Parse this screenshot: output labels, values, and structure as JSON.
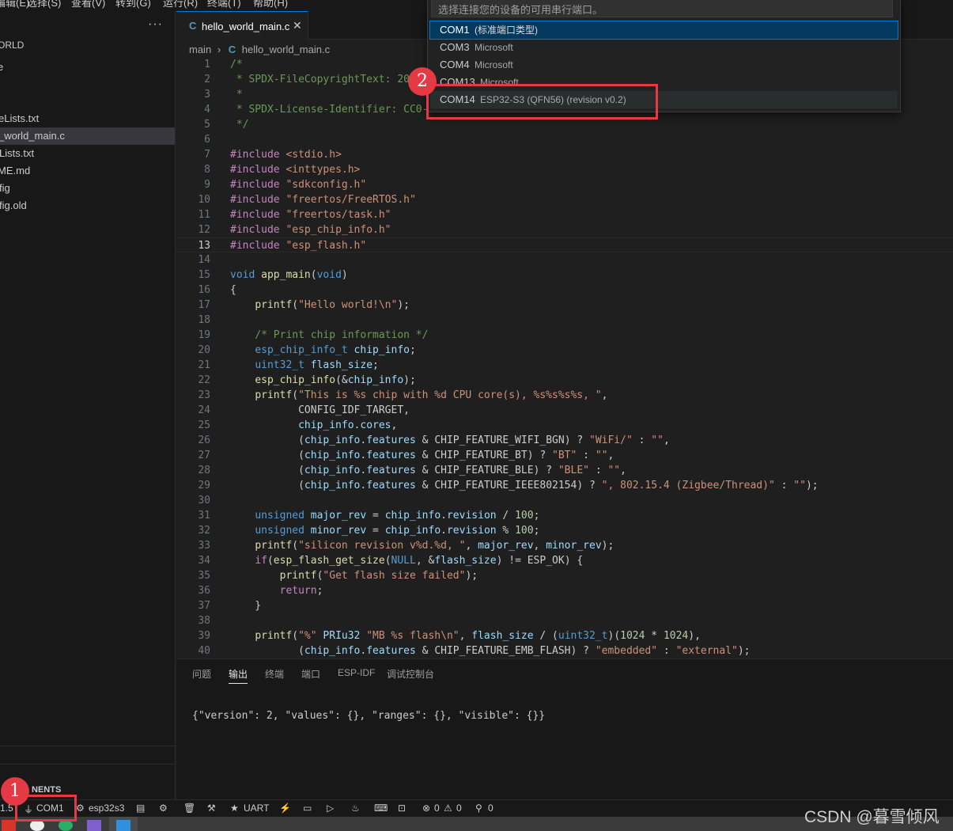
{
  "menubar": {
    "items": [
      "编辑(E)",
      "选择(S)",
      "查看(V)",
      "转到(G)",
      "运行(R)",
      "终端(T)",
      "帮助(H)"
    ]
  },
  "sidebar": {
    "title": "ORLD",
    "more_label": "···",
    "items": [
      {
        "label": "e"
      },
      {
        "label": "eLists.txt"
      },
      {
        "label": "_world_main.c",
        "selected": true
      },
      {
        "label": "Lists.txt"
      },
      {
        "label": "ME.md"
      },
      {
        "label": "fig"
      },
      {
        "label": "fig.old"
      }
    ],
    "components_label": "NENTS"
  },
  "tabs": [
    {
      "label": "hello_world_main.c",
      "icon": "c-file-icon",
      "active": true
    }
  ],
  "breadcrumb": {
    "folder": "main",
    "separator": "›",
    "file": "hello_world_main.c"
  },
  "editor": {
    "current_line": 13,
    "lines": [
      {
        "n": "1",
        "t": "/*"
      },
      {
        "n": "2",
        "t": " * SPDX-FileCopyrightText: 20"
      },
      {
        "n": "3",
        "t": " *"
      },
      {
        "n": "4",
        "t": " * SPDX-License-Identifier: CC0-"
      },
      {
        "n": "5",
        "t": " */"
      },
      {
        "n": "6",
        "t": ""
      },
      {
        "n": "7",
        "t": "#include <stdio.h>"
      },
      {
        "n": "8",
        "t": "#include <inttypes.h>"
      },
      {
        "n": "9",
        "t": "#include \"sdkconfig.h\""
      },
      {
        "n": "10",
        "t": "#include \"freertos/FreeRTOS.h\""
      },
      {
        "n": "11",
        "t": "#include \"freertos/task.h\""
      },
      {
        "n": "12",
        "t": "#include \"esp_chip_info.h\""
      },
      {
        "n": "13",
        "t": "#include \"esp_flash.h\""
      },
      {
        "n": "14",
        "t": ""
      },
      {
        "n": "15",
        "t": "void app_main(void)"
      },
      {
        "n": "16",
        "t": "{"
      },
      {
        "n": "17",
        "t": "    printf(\"Hello world!\\n\");"
      },
      {
        "n": "18",
        "t": ""
      },
      {
        "n": "19",
        "t": "    /* Print chip information */"
      },
      {
        "n": "20",
        "t": "    esp_chip_info_t chip_info;"
      },
      {
        "n": "21",
        "t": "    uint32_t flash_size;"
      },
      {
        "n": "22",
        "t": "    esp_chip_info(&chip_info);"
      },
      {
        "n": "23",
        "t": "    printf(\"This is %s chip with %d CPU core(s), %s%s%s%s, \","
      },
      {
        "n": "24",
        "t": "           CONFIG_IDF_TARGET,"
      },
      {
        "n": "25",
        "t": "           chip_info.cores,"
      },
      {
        "n": "26",
        "t": "           (chip_info.features & CHIP_FEATURE_WIFI_BGN) ? \"WiFi/\" : \"\","
      },
      {
        "n": "27",
        "t": "           (chip_info.features & CHIP_FEATURE_BT) ? \"BT\" : \"\","
      },
      {
        "n": "28",
        "t": "           (chip_info.features & CHIP_FEATURE_BLE) ? \"BLE\" : \"\","
      },
      {
        "n": "29",
        "t": "           (chip_info.features & CHIP_FEATURE_IEEE802154) ? \", 802.15.4 (Zigbee/Thread)\" : \"\");"
      },
      {
        "n": "30",
        "t": ""
      },
      {
        "n": "31",
        "t": "    unsigned major_rev = chip_info.revision / 100;"
      },
      {
        "n": "32",
        "t": "    unsigned minor_rev = chip_info.revision % 100;"
      },
      {
        "n": "33",
        "t": "    printf(\"silicon revision v%d.%d, \", major_rev, minor_rev);"
      },
      {
        "n": "34",
        "t": "    if(esp_flash_get_size(NULL, &flash_size) != ESP_OK) {"
      },
      {
        "n": "35",
        "t": "        printf(\"Get flash size failed\");"
      },
      {
        "n": "36",
        "t": "        return;"
      },
      {
        "n": "37",
        "t": "    }"
      },
      {
        "n": "38",
        "t": ""
      },
      {
        "n": "39",
        "t": "    printf(\"%\" PRIu32 \"MB %s flash\\n\", flash_size / (uint32_t)(1024 * 1024),"
      },
      {
        "n": "40",
        "t": "           (chip_info.features & CHIP_FEATURE_EMB_FLASH) ? \"embedded\" : \"external\");"
      }
    ]
  },
  "panel": {
    "tabs": [
      "问题",
      "输出",
      "终端",
      "端口",
      "ESP-IDF",
      "调试控制台"
    ],
    "active_tab": "输出",
    "output": "{\"version\": 2, \"values\": {}, \"ranges\": {}, \"visible\": {}}"
  },
  "quickpick": {
    "placeholder": "选择连接您的设备的可用串行端口。",
    "items": [
      {
        "name": "COM1",
        "desc": "(标准端口类型)",
        "state": "active"
      },
      {
        "name": "COM3",
        "desc": "Microsoft",
        "state": ""
      },
      {
        "name": "COM4",
        "desc": "Microsoft",
        "state": ""
      },
      {
        "name": "COM13",
        "desc": "Microsoft",
        "state": ""
      },
      {
        "name": "COM14",
        "desc": "ESP32-S3 (QFN56) (revision v0.2)",
        "state": "hover"
      }
    ]
  },
  "statusbar": {
    "version_fragment": "1.5",
    "port": "COM1",
    "target": "esp32s3",
    "flash_method": "UART",
    "errors": "0",
    "warnings": "0",
    "ports_count": "0"
  },
  "annotations": {
    "badge1": "1",
    "badge2": "2"
  },
  "watermark": "CSDN @暮雪倾风",
  "colors": {
    "accent": "#0078d4",
    "annotation_red": "#e43a45",
    "keyword": "#569cd6",
    "string": "#ce9178",
    "comment": "#6a9955",
    "include": "#c586c0",
    "function": "#dcdcaa",
    "variable": "#9cdcfe",
    "number": "#b5cea8",
    "type": "#4ec9b0"
  }
}
